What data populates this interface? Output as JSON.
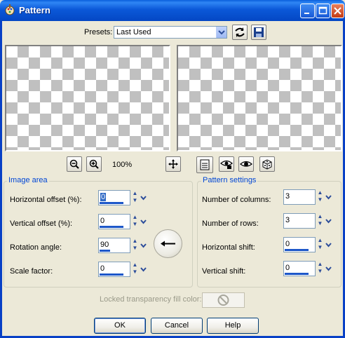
{
  "window": {
    "title": "Pattern"
  },
  "presets": {
    "label": "Presets:",
    "value": "Last Used"
  },
  "zoom": {
    "level": "100%"
  },
  "image_area": {
    "title": "Image area",
    "horizontal_offset": {
      "label": "Horizontal offset (%):",
      "value": "0"
    },
    "vertical_offset": {
      "label": "Vertical offset (%):",
      "value": "0"
    },
    "rotation_angle": {
      "label": "Rotation angle:",
      "value": "90"
    },
    "scale_factor": {
      "label": "Scale factor:",
      "value": "0"
    }
  },
  "pattern_settings": {
    "title": "Pattern settings",
    "columns": {
      "label": "Number of columns:",
      "value": "3"
    },
    "rows": {
      "label": "Number of rows:",
      "value": "3"
    },
    "horizontal_shift": {
      "label": "Horizontal shift:",
      "value": "0"
    },
    "vertical_shift": {
      "label": "Vertical shift:",
      "value": "0"
    }
  },
  "locked_fill": {
    "label": "Locked transparency fill color:"
  },
  "buttons": {
    "ok": "OK",
    "cancel": "Cancel",
    "help": "Help"
  },
  "colors": {
    "title_bar": "#0a5fdc",
    "group_title": "#0046d5",
    "dialog_bg": "#ece9d8",
    "disabled_text": "#9a9a8a"
  }
}
